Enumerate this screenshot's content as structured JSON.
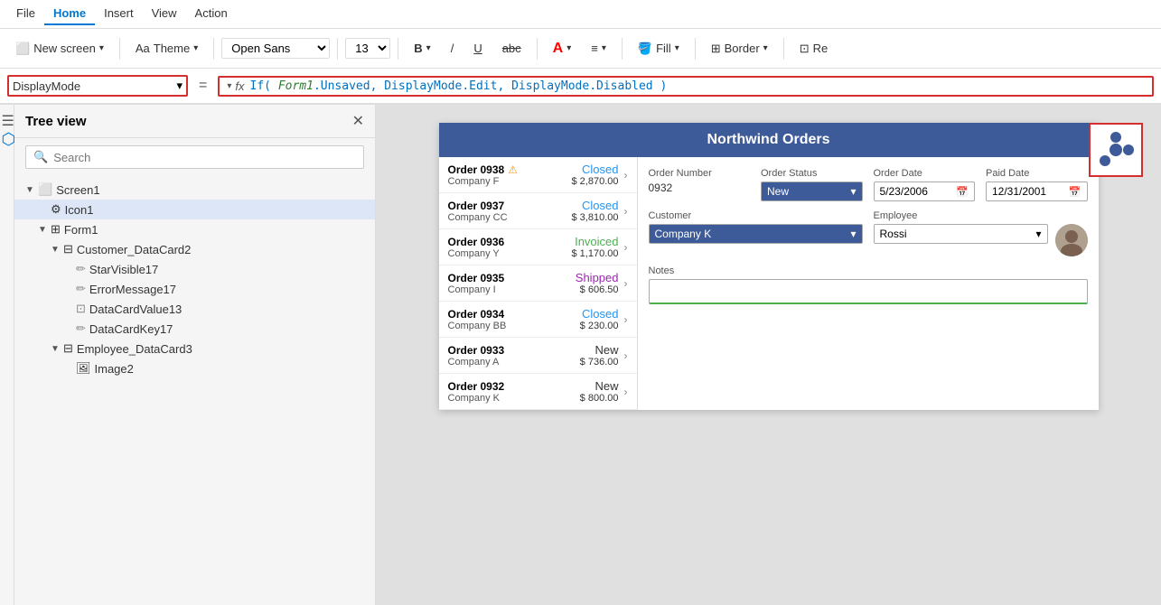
{
  "menubar": {
    "items": [
      {
        "label": "File",
        "active": false
      },
      {
        "label": "Home",
        "active": true
      },
      {
        "label": "Insert",
        "active": false
      },
      {
        "label": "View",
        "active": false
      },
      {
        "label": "Action",
        "active": false
      }
    ]
  },
  "toolbar": {
    "new_screen_label": "New screen",
    "theme_label": "Theme",
    "font_family": "Open Sans",
    "font_size": "13",
    "bold_label": "B",
    "italic_label": "/",
    "underline_label": "U",
    "strikethrough_label": "abc",
    "font_color_label": "A",
    "align_label": "≡",
    "fill_label": "Fill",
    "border_label": "Border",
    "reorder_label": "Re"
  },
  "formula_bar": {
    "property_name": "DisplayMode",
    "fx_label": "fx",
    "formula": "If( Form1.Unsaved, DisplayMode.Edit, DisplayMode.Disabled )"
  },
  "sidebar": {
    "title": "Tree view",
    "search_placeholder": "Search",
    "tree": [
      {
        "id": "screen1",
        "label": "Screen1",
        "level": 0,
        "hasArrow": true,
        "expanded": true,
        "icon": "screen"
      },
      {
        "id": "icon1",
        "label": "Icon1",
        "level": 1,
        "hasArrow": false,
        "expanded": false,
        "icon": "icon",
        "selected": true
      },
      {
        "id": "form1",
        "label": "Form1",
        "level": 1,
        "hasArrow": true,
        "expanded": true,
        "icon": "form"
      },
      {
        "id": "customer_dc2",
        "label": "Customer_DataCard2",
        "level": 2,
        "hasArrow": true,
        "expanded": true,
        "icon": "card"
      },
      {
        "id": "starvisible17",
        "label": "StarVisible17",
        "level": 3,
        "hasArrow": false,
        "icon": "edit"
      },
      {
        "id": "errormessage17",
        "label": "ErrorMessage17",
        "level": 3,
        "hasArrow": false,
        "icon": "edit"
      },
      {
        "id": "datacardvalue13",
        "label": "DataCardValue13",
        "level": 3,
        "hasArrow": false,
        "icon": "input"
      },
      {
        "id": "datacardkey17",
        "label": "DataCardKey17",
        "level": 3,
        "hasArrow": false,
        "icon": "edit"
      },
      {
        "id": "employee_dc3",
        "label": "Employee_DataCard3",
        "level": 2,
        "hasArrow": true,
        "expanded": true,
        "icon": "card"
      },
      {
        "id": "image2",
        "label": "Image2",
        "level": 3,
        "hasArrow": false,
        "icon": "image"
      }
    ]
  },
  "app_preview": {
    "title": "Northwind Orders",
    "orders": [
      {
        "num": "Order 0938",
        "company": "Company F",
        "status": "Closed",
        "amount": "$ 2,870.00",
        "statusClass": "closed",
        "hasWarning": true
      },
      {
        "num": "Order 0937",
        "company": "Company CC",
        "status": "Closed",
        "amount": "$ 3,810.00",
        "statusClass": "closed",
        "hasWarning": false
      },
      {
        "num": "Order 0936",
        "company": "Company Y",
        "status": "Invoiced",
        "amount": "$ 1,170.00",
        "statusClass": "invoiced",
        "hasWarning": false
      },
      {
        "num": "Order 0935",
        "company": "Company I",
        "status": "Shipped",
        "amount": "$ 606.50",
        "statusClass": "shipped",
        "hasWarning": false
      },
      {
        "num": "Order 0934",
        "company": "Company BB",
        "status": "Closed",
        "amount": "$ 230.00",
        "statusClass": "closed",
        "hasWarning": false
      },
      {
        "num": "Order 0933",
        "company": "Company A",
        "status": "New",
        "amount": "$ 736.00",
        "statusClass": "new",
        "hasWarning": false
      },
      {
        "num": "Order 0932",
        "company": "Company K",
        "status": "New",
        "amount": "$ 800.00",
        "statusClass": "new",
        "hasWarning": false
      }
    ],
    "detail": {
      "order_number_label": "Order Number",
      "order_number_value": "0932",
      "order_status_label": "Order Status",
      "order_status_value": "New",
      "order_date_label": "Order Date",
      "order_date_value": "5/23/2006",
      "paid_date_label": "Paid Date",
      "paid_date_value": "12/31/2001",
      "customer_label": "Customer",
      "customer_value": "Company K",
      "employee_label": "Employee",
      "employee_value": "Rossi",
      "notes_label": "Notes",
      "notes_value": ""
    }
  }
}
